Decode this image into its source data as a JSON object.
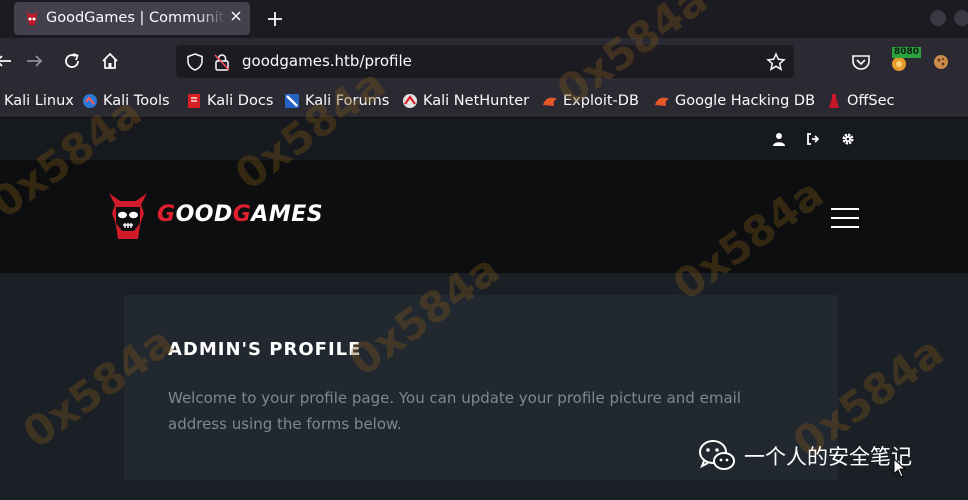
{
  "browser": {
    "tab": {
      "title": "GoodGames | Community",
      "favicon": "skull-favicon",
      "close_icon": "close-icon"
    },
    "new_tab_icon": "plus-icon",
    "toolbar": {
      "back_icon": "arrow-left-icon",
      "forward_icon": "arrow-right-icon",
      "reload_icon": "reload-icon",
      "home_icon": "home-icon",
      "url": "goodgames.htb/profile",
      "shield_icon": "shield-icon",
      "lock_icon": "lock-slash-icon",
      "bookmark_icon": "star-icon",
      "pocket_icon": "pocket-icon",
      "proxy_badge": "8080",
      "extension_icon": "cookie-icon"
    },
    "bookmarks": [
      {
        "label": "Kali Linux",
        "icon": "kali-icon"
      },
      {
        "label": "Kali Tools",
        "icon": "kali-tools-icon"
      },
      {
        "label": "Kali Docs",
        "icon": "kali-docs-icon"
      },
      {
        "label": "Kali Forums",
        "icon": "kali-forums-icon"
      },
      {
        "label": "Kali NetHunter",
        "icon": "nethunter-icon"
      },
      {
        "label": "Exploit-DB",
        "icon": "exploitdb-icon"
      },
      {
        "label": "Google Hacking DB",
        "icon": "ghdb-icon"
      },
      {
        "label": "OffSec",
        "icon": "offsec-icon"
      }
    ]
  },
  "page": {
    "topbar": {
      "icons": [
        "user-icon",
        "logout-icon",
        "gear-icon"
      ]
    },
    "logo": {
      "prefix": "G",
      "part1": "OOD",
      "g2": "G",
      "part2": "AMES"
    },
    "menu_icon": "hamburger-icon",
    "profile": {
      "title": "ADMIN'S PROFILE",
      "description": "Welcome to your profile page. You can update your profile picture and email address using the forms below."
    }
  },
  "overlay": {
    "watermark": "0x584a",
    "wechat_label": "一个人的安全笔记",
    "wechat_icon": "wechat-icon"
  },
  "colors": {
    "accent_red": "#e02030",
    "page_bg": "#1b2026",
    "header_bg": "#0c0e10",
    "card_bg": "#22282f"
  }
}
